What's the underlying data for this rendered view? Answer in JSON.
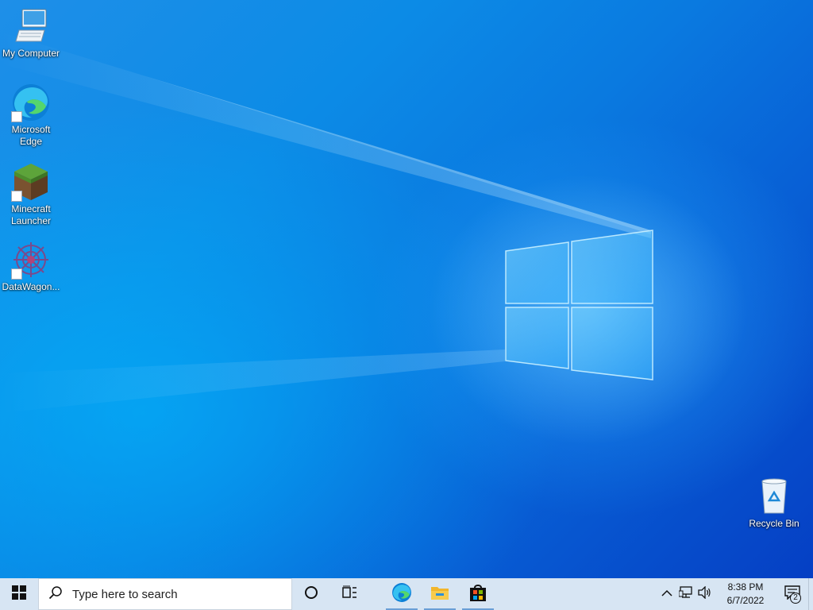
{
  "desktop": {
    "icons": [
      {
        "label": "My Computer",
        "icon": "computer-icon"
      },
      {
        "label": "Microsoft Edge",
        "icon": "edge-icon"
      },
      {
        "label": "Minecraft Launcher",
        "icon": "minecraft-icon"
      },
      {
        "label": "DataWagon...",
        "icon": "datawagon-icon"
      },
      {
        "label": "Recycle Bin",
        "icon": "recycle-bin-icon"
      }
    ]
  },
  "taskbar": {
    "start_icon": "windows-logo-icon",
    "search_placeholder": "Type here to search",
    "cortana_icon": "cortana-circle-icon",
    "task_view_icon": "task-view-icon",
    "pinned": [
      {
        "name": "Microsoft Edge",
        "icon": "edge-icon"
      },
      {
        "name": "File Explorer",
        "icon": "folder-icon"
      },
      {
        "name": "Microsoft Store",
        "icon": "store-icon"
      }
    ],
    "tray": {
      "chevron_icon": "chevron-up-icon",
      "network_icon": "network-icon",
      "volume_icon": "volume-icon",
      "time": "8:38 PM",
      "date": "6/7/2022",
      "notification_count": "2"
    }
  },
  "colors": {
    "taskbar_bg": "#d7e5f3",
    "wallpaper_accent": "#0a7ae0"
  }
}
